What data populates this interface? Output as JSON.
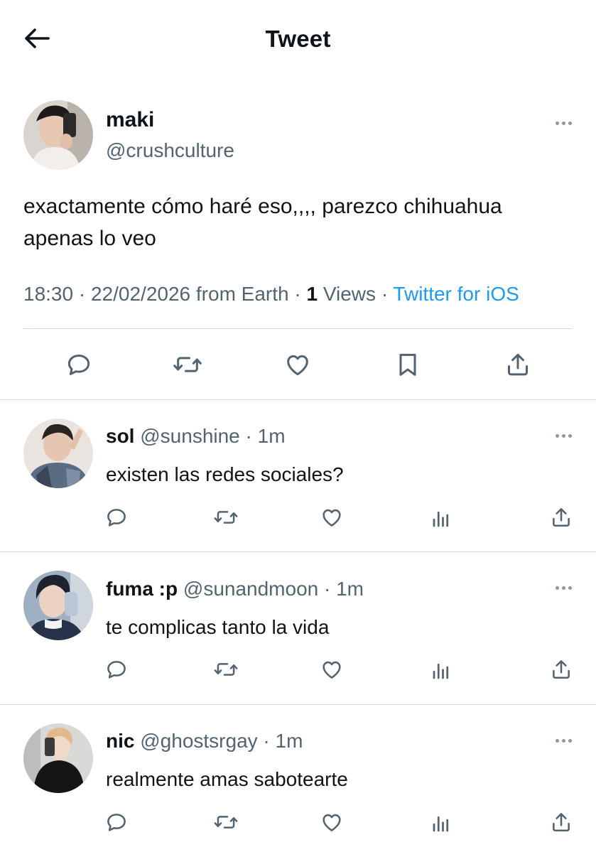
{
  "header": {
    "title": "Tweet"
  },
  "tweet": {
    "name": "maki",
    "handle": "@crushculture",
    "text": "exactamente cómo haré eso,,,, parezco chihuahua apenas lo veo",
    "time": "18:30",
    "date": "22/02/2026",
    "location": "from Earth",
    "views_count": "1",
    "views_label": "Views",
    "source": "Twitter for iOS"
  },
  "replies": [
    {
      "name": "sol",
      "handle": "@sunshine",
      "time": "1m",
      "text": "existen las redes sociales?"
    },
    {
      "name": "fuma :p",
      "handle": "@sunandmoon",
      "time": "1m",
      "text": "te complicas tanto la vida"
    },
    {
      "name": "nic",
      "handle": "@ghostsrgay",
      "time": "1m",
      "text": "realmente amas sabotearte"
    }
  ],
  "colors": {
    "text": "#0f1419",
    "secondary": "#536471",
    "link": "#1d9bf0",
    "divider": "#d5dbe0",
    "icon": "#536471"
  },
  "icons": {
    "tweet_actions": [
      "reply-icon",
      "retweet-icon",
      "like-icon",
      "bookmark-icon",
      "share-icon"
    ],
    "reply_actions": [
      "reply-icon",
      "retweet-icon",
      "like-icon",
      "views-icon",
      "share-icon"
    ]
  }
}
